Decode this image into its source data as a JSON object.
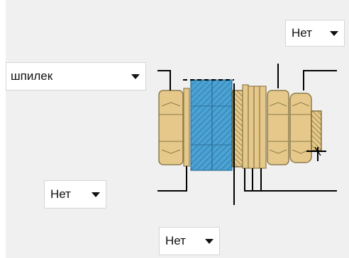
{
  "dropdowns": {
    "top_right": {
      "selected": "Нет"
    },
    "left": {
      "selected": "шпилек"
    },
    "bottom_left": {
      "selected": "Нет"
    },
    "bottom_center": {
      "selected": "Нет"
    }
  },
  "colors": {
    "panel_bg": "#f0f0f0",
    "nut_fill": "#e6c98a",
    "nut_stroke": "#8b7a4a",
    "plate_fill": "#4aa3d4",
    "line": "#000000"
  },
  "icons": {
    "dropdown_arrow": "chevron-down-icon"
  }
}
